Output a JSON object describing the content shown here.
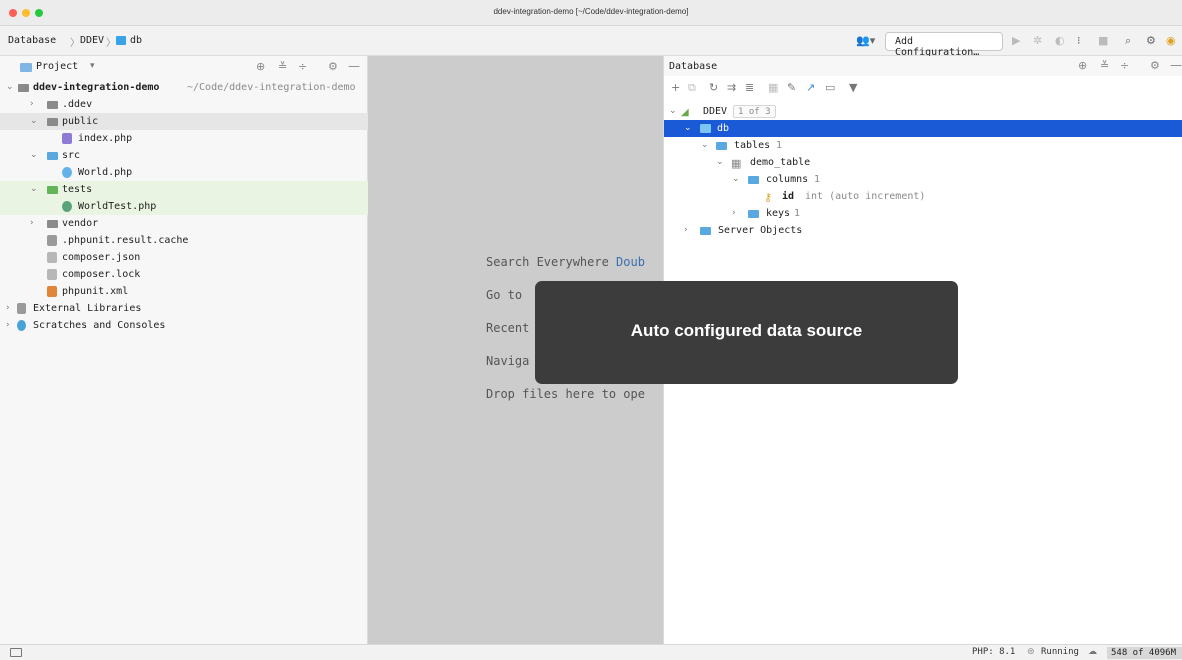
{
  "window": {
    "title": "ddev-integration-demo [~/Code/ddev-integration-demo]"
  },
  "navbar": {
    "breadcrumbs": [
      "Database",
      "DDEV",
      "db"
    ],
    "add_configuration": "Add Configuration…"
  },
  "project_panel": {
    "title": "Project",
    "tree": [
      {
        "label": "ddev-integration-demo",
        "path": "~/Code/ddev-integration-demo"
      },
      {
        "label": ".ddev"
      },
      {
        "label": "public"
      },
      {
        "label": "index.php"
      },
      {
        "label": "src"
      },
      {
        "label": "World.php"
      },
      {
        "label": "tests"
      },
      {
        "label": "WorldTest.php"
      },
      {
        "label": "vendor"
      },
      {
        "label": ".phpunit.result.cache"
      },
      {
        "label": "composer.json"
      },
      {
        "label": "composer.lock"
      },
      {
        "label": "phpunit.xml"
      },
      {
        "label": "External Libraries"
      },
      {
        "label": "Scratches and Consoles"
      }
    ]
  },
  "editor": {
    "hints": [
      {
        "text": "Search Everywhere ",
        "key": "Doub"
      },
      {
        "text": "Go to",
        "key": ""
      },
      {
        "text": "Recent",
        "key": ""
      },
      {
        "text": "Naviga",
        "key": ""
      },
      {
        "text": "Drop files here to ope",
        "key": ""
      }
    ]
  },
  "database_panel": {
    "title": "Database",
    "tree": {
      "ddev": {
        "label": "DDEV",
        "badge": "1 of 3"
      },
      "db": {
        "label": "db"
      },
      "tables": {
        "label": "tables",
        "count": "1"
      },
      "demo_table": {
        "label": "demo_table"
      },
      "columns": {
        "label": "columns",
        "count": "1"
      },
      "id_column": {
        "label": "id",
        "type": "int (auto increment)"
      },
      "keys": {
        "label": "keys",
        "count": "1"
      },
      "server_objects": {
        "label": "Server Objects"
      }
    }
  },
  "toast": {
    "message": "Auto configured data source"
  },
  "statusbar": {
    "php": "PHP: 8.1",
    "running": "Running",
    "memory": "548 of 4096M"
  },
  "colors": {
    "selection": "#1a5ad7",
    "toast_bg": "#3c3c3c",
    "test_row": "#e9f4e2"
  }
}
